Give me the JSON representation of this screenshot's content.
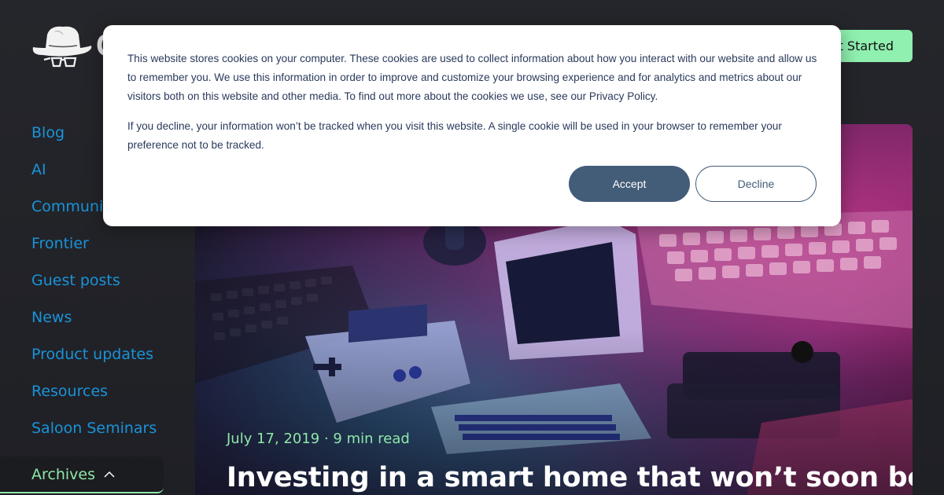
{
  "header": {
    "brand_icon": "cowboy-hat-glasses-icon",
    "brand_text": "Gruntwork",
    "cta_label": "Get Started",
    "cta_color": "#8ff0b0"
  },
  "sidebar": {
    "items": [
      {
        "label": "Blog"
      },
      {
        "label": "AI"
      },
      {
        "label": "Community"
      },
      {
        "label": "Frontier"
      },
      {
        "label": "Guest posts"
      },
      {
        "label": "News"
      },
      {
        "label": "Product updates"
      },
      {
        "label": "Resources"
      },
      {
        "label": "Saloon Seminars"
      }
    ],
    "archives": {
      "label": "Archives",
      "icon": "chevron-up-icon",
      "expanded": true
    },
    "link_color": "#1a93d9",
    "active_color": "#8fe6a8"
  },
  "hero": {
    "meta": "July 17, 2019 · 9 min read",
    "title": "Investing in a smart home that won’t soon be"
  },
  "cookie_banner": {
    "paragraph1": "This website stores cookies on your computer. These cookies are used to collect information about how you interact with our website and allow us to remember you. We use this information in order to improve and customize your browsing experience and for analytics and metrics about our visitors both on this website and other media. To find out more about the cookies we use, see our Privacy Policy.",
    "paragraph2": "If you decline, your information won’t be tracked when you visit this website. A single cookie will be used in your browser to remember your preference not to be tracked.",
    "accept_label": "Accept",
    "decline_label": "Decline",
    "button_color": "#435c78"
  }
}
